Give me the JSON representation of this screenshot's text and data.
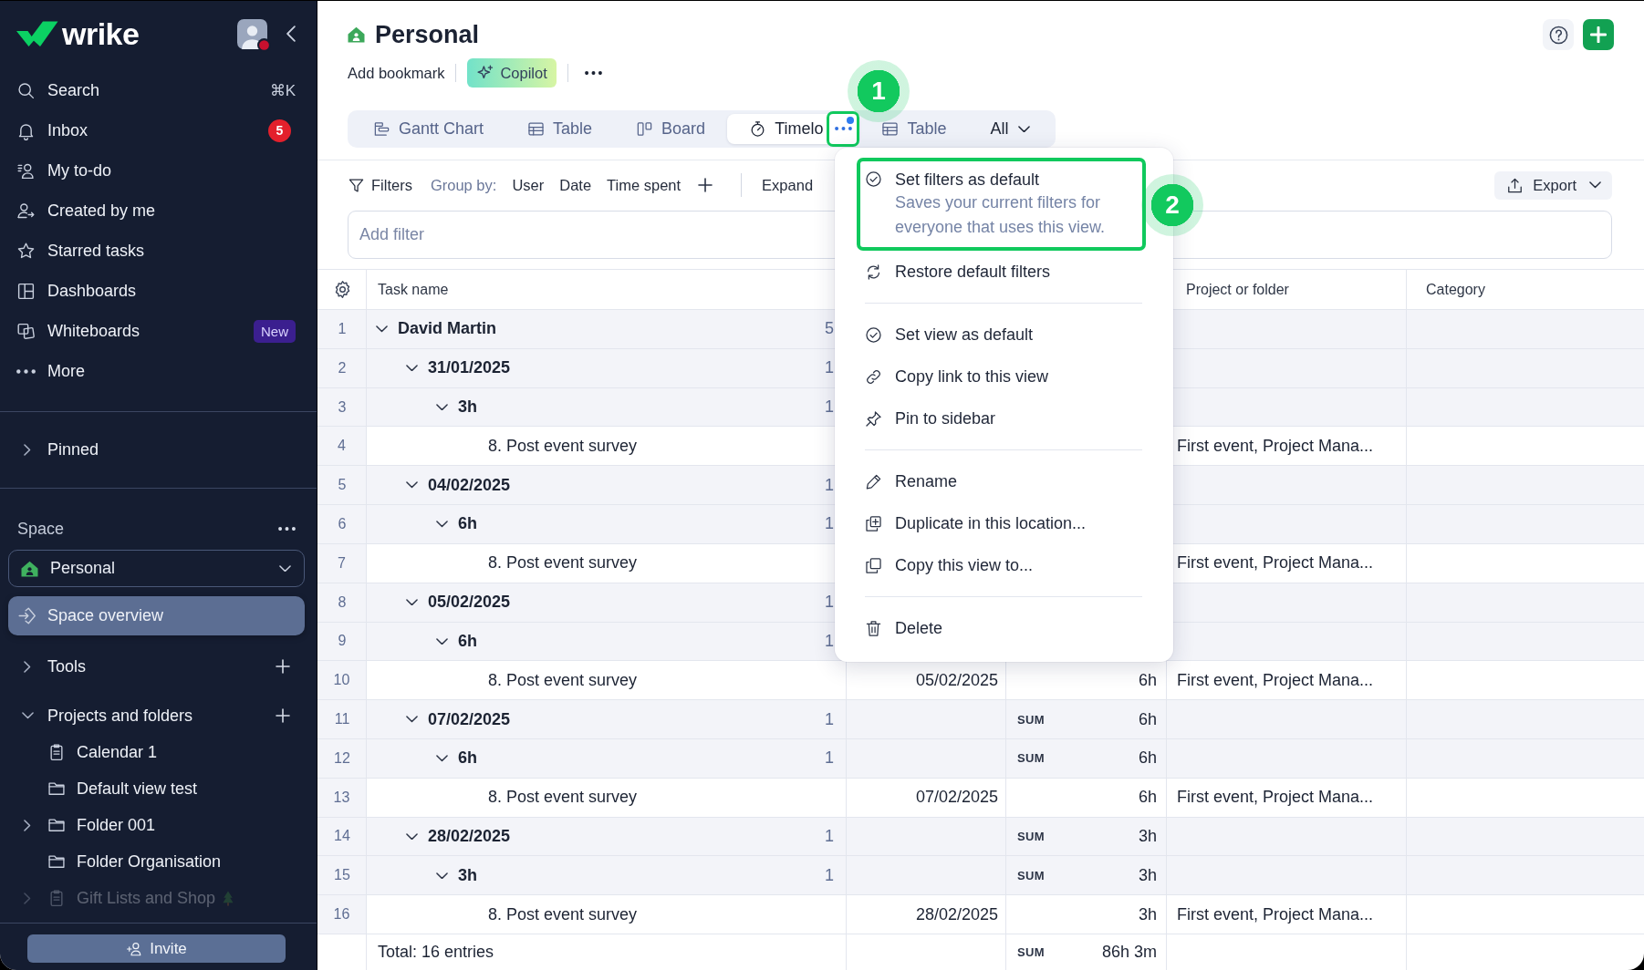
{
  "sidebar": {
    "logo": "wrike",
    "nav": [
      {
        "label": "Search",
        "shortcut": "⌘K"
      },
      {
        "label": "Inbox",
        "badge": "5"
      },
      {
        "label": "My to-do"
      },
      {
        "label": "Created by me"
      },
      {
        "label": "Starred tasks"
      },
      {
        "label": "Dashboards"
      },
      {
        "label": "Whiteboards",
        "tag": "New"
      },
      {
        "label": "More"
      }
    ],
    "pinned": {
      "label": "Pinned",
      "expanded": false
    },
    "space": {
      "label": "Space",
      "selector": "Personal",
      "overview": {
        "label": "Space overview",
        "selected": true
      },
      "sections": [
        {
          "label": "Tools",
          "expanded": false
        },
        {
          "label": "Projects and folders",
          "expanded": true,
          "children": [
            {
              "label": "Calendar 1",
              "kind": "project",
              "expandable": false,
              "faded": false,
              "trailing_icon": false
            },
            {
              "label": "Default view test",
              "kind": "folder",
              "expandable": false,
              "faded": false,
              "trailing_icon": false
            },
            {
              "label": "Folder 001",
              "kind": "folder",
              "expandable": true,
              "faded": false,
              "trailing_icon": false
            },
            {
              "label": "Folder Organisation",
              "kind": "folder",
              "expandable": false,
              "faded": false,
              "trailing_icon": false
            },
            {
              "label": "Gift Lists and Shop",
              "kind": "project",
              "expandable": true,
              "faded": true,
              "trailing_icon": true
            }
          ]
        }
      ]
    },
    "invite": "Invite"
  },
  "header": {
    "title": "Personal",
    "bookmark": "Add bookmark",
    "copilot": "Copilot"
  },
  "views": [
    {
      "label": "Gantt Chart",
      "kind": "gantt",
      "selected": false
    },
    {
      "label": "Table",
      "kind": "table",
      "selected": false
    },
    {
      "label": "Board",
      "kind": "board",
      "selected": false
    },
    {
      "label": "Timelo",
      "kind": "timer",
      "selected": true,
      "menu_button": {
        "highlighted": true,
        "dot": true,
        "step": "1"
      }
    },
    {
      "label": "Table",
      "kind": "table",
      "selected": false
    },
    {
      "label": "All",
      "kind": "dropdown",
      "selected": false
    }
  ],
  "toolbar": {
    "filters": "Filters",
    "group_by_label": "Group by:",
    "group_by": [
      "User",
      "Date",
      "Time spent"
    ],
    "expand": "Expand",
    "export": "Export"
  },
  "filter_field": {
    "placeholder": "Add filter"
  },
  "table": {
    "header": {
      "task_name": "Task name",
      "project": "Project or folder",
      "category": "Category"
    },
    "rows": [
      {
        "number": "1",
        "kind": "group",
        "label": "David Martin",
        "count": "5",
        "expanded": true,
        "children": [
          {
            "number": "2",
            "kind": "group",
            "label": "31/01/2025",
            "count": "1",
            "expanded": true,
            "children": [
              {
                "number": "3",
                "kind": "group",
                "label": "3h",
                "count": "1",
                "expanded": true,
                "children": [
                  {
                    "number": "4",
                    "kind": "task",
                    "label": "8. Post event survey",
                    "project": "First event, Project Mana..."
                  }
                ]
              }
            ]
          },
          {
            "number": "5",
            "kind": "group",
            "label": "04/02/2025",
            "count": "1",
            "expanded": true,
            "children": [
              {
                "number": "6",
                "kind": "group",
                "label": "6h",
                "count": "1",
                "expanded": true,
                "children": [
                  {
                    "number": "7",
                    "kind": "task",
                    "label": "8. Post event survey",
                    "project": "First event, Project Mana..."
                  }
                ]
              }
            ]
          },
          {
            "number": "8",
            "kind": "group",
            "label": "05/02/2025",
            "count": "1",
            "expanded": true,
            "children": [
              {
                "number": "9",
                "kind": "group",
                "label": "6h",
                "count": "1",
                "expanded": true,
                "children": [
                  {
                    "number": "10",
                    "kind": "task",
                    "label": "8. Post event survey",
                    "column_2": "05/02/2025",
                    "column_3": "6h",
                    "project": "First event, Project Mana..."
                  }
                ]
              }
            ]
          },
          {
            "number": "11",
            "kind": "group",
            "label": "07/02/2025",
            "count": "1",
            "expanded": true,
            "aggregate": "SUM",
            "column_3": "6h",
            "children": [
              {
                "number": "12",
                "kind": "group",
                "label": "6h",
                "count": "1",
                "expanded": true,
                "aggregate": "SUM",
                "column_3": "6h",
                "children": [
                  {
                    "number": "13",
                    "kind": "task",
                    "label": "8. Post event survey",
                    "column_2": "07/02/2025",
                    "column_3": "6h",
                    "project": "First event, Project Mana..."
                  }
                ]
              }
            ]
          },
          {
            "number": "14",
            "kind": "group",
            "label": "28/02/2025",
            "count": "1",
            "expanded": true,
            "aggregate": "SUM",
            "column_3": "3h",
            "children": [
              {
                "number": "15",
                "kind": "group",
                "label": "3h",
                "count": "1",
                "expanded": true,
                "aggregate": "SUM",
                "column_3": "3h",
                "children": [
                  {
                    "number": "16",
                    "kind": "task",
                    "label": "8. Post event survey",
                    "column_2": "28/02/2025",
                    "column_3": "3h",
                    "project": "First event, Project Mana..."
                  }
                ]
              }
            ]
          }
        ]
      }
    ],
    "total": {
      "label": "Total: 16 entries",
      "aggregate": "SUM",
      "column_3": "86h 3m"
    }
  },
  "menu": {
    "groups": [
      {
        "items": [
          {
            "label": "Set filters as default",
            "description": "Saves your current filters for everyone that uses this view.",
            "highlighted": true,
            "step": "2"
          },
          {
            "label": "Restore default filters",
            "highlighted": false
          }
        ]
      },
      {
        "items": [
          {
            "label": "Set view as default",
            "highlighted": false
          },
          {
            "label": "Copy link to this view",
            "highlighted": false
          },
          {
            "label": "Pin to sidebar",
            "highlighted": false
          }
        ]
      },
      {
        "items": [
          {
            "label": "Rename",
            "highlighted": false
          },
          {
            "label": "Duplicate in this location...",
            "highlighted": false
          },
          {
            "label": "Copy this view to...",
            "highlighted": false
          }
        ]
      },
      {
        "items": [
          {
            "label": "Delete",
            "highlighted": false
          }
        ]
      }
    ]
  }
}
